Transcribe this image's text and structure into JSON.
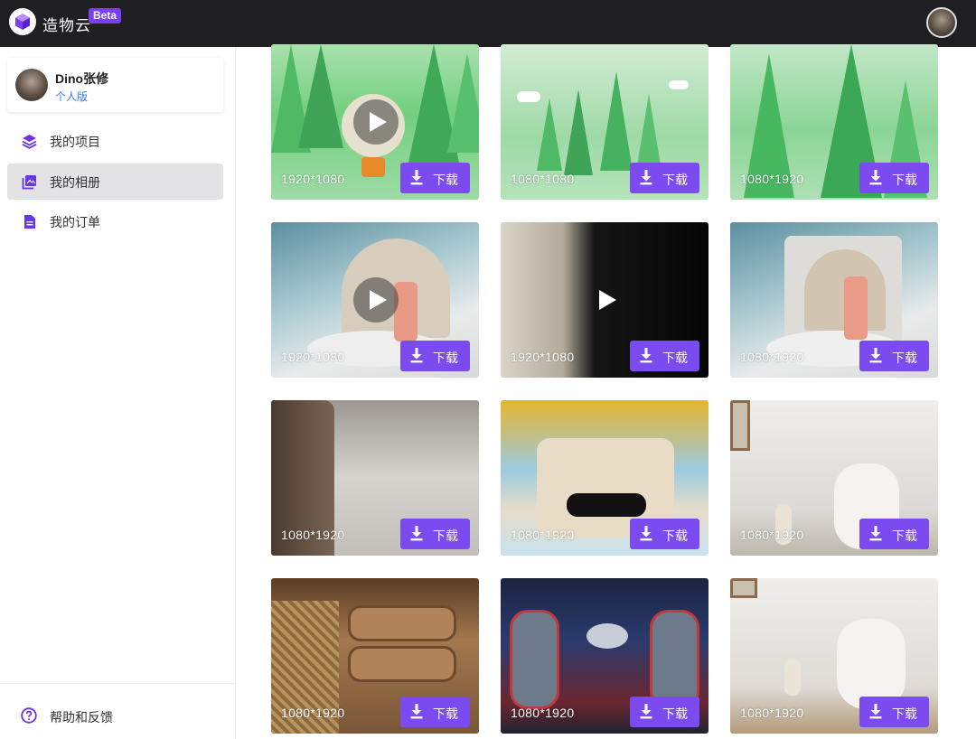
{
  "app": {
    "name": "造物云",
    "badge": "Beta"
  },
  "user": {
    "name": "Dino张修",
    "plan": "个人版"
  },
  "nav": [
    {
      "label": "我的项目",
      "icon": "layers-icon",
      "active": false
    },
    {
      "label": "我的相册",
      "icon": "photo-album-icon",
      "active": true
    },
    {
      "label": "我的订单",
      "icon": "document-icon",
      "active": false
    }
  ],
  "footer": {
    "help_label": "帮助和反馈"
  },
  "colors": {
    "topbar": "#1f1f21",
    "accent": "#7c4bf0",
    "beta": "#7b3ff2",
    "plan_link": "#3a7afe"
  },
  "download_label": "下载",
  "gallery": [
    {
      "resolution": "1920*1080",
      "video": true,
      "scene": "green cone trees with cartoon character"
    },
    {
      "resolution": "1080*1080",
      "video": false,
      "scene": "green cone trees with clouds"
    },
    {
      "resolution": "1080*1920",
      "video": false,
      "scene": "green cone trees"
    },
    {
      "resolution": "1920*1080",
      "video": true,
      "scene": "cosmetic bottle on pedestal"
    },
    {
      "resolution": "1920*1080",
      "video": true,
      "scene": "dark blurred closeup"
    },
    {
      "resolution": "1080*1920",
      "video": false,
      "scene": "cosmetic bottle on pedestal"
    },
    {
      "resolution": "1080*1920",
      "video": false,
      "scene": "floor with leather sofa"
    },
    {
      "resolution": "1080*1920",
      "video": false,
      "scene": "portable device with umbrella"
    },
    {
      "resolution": "1080*1920",
      "video": false,
      "scene": "white device with dried pampas"
    },
    {
      "resolution": "1080*1920",
      "video": false,
      "scene": "wooden rattan cabinet"
    },
    {
      "resolution": "1080*1920",
      "video": false,
      "scene": "sci-fi robot room"
    },
    {
      "resolution": "1080*1920",
      "video": false,
      "scene": "white device with dried pampas"
    }
  ]
}
